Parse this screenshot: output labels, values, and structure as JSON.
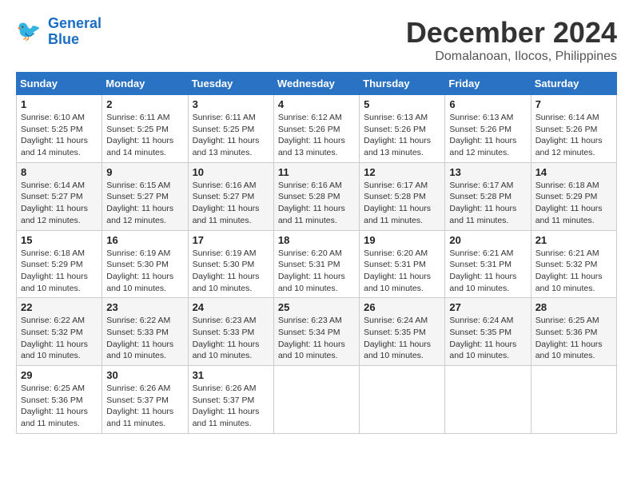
{
  "logo": {
    "line1": "General",
    "line2": "Blue"
  },
  "title": "December 2024",
  "location": "Domalanoan, Ilocos, Philippines",
  "days_of_week": [
    "Sunday",
    "Monday",
    "Tuesday",
    "Wednesday",
    "Thursday",
    "Friday",
    "Saturday"
  ],
  "weeks": [
    [
      {
        "day": "1",
        "sunrise": "6:10 AM",
        "sunset": "5:25 PM",
        "daylight": "11 hours and 14 minutes."
      },
      {
        "day": "2",
        "sunrise": "6:11 AM",
        "sunset": "5:25 PM",
        "daylight": "11 hours and 14 minutes."
      },
      {
        "day": "3",
        "sunrise": "6:11 AM",
        "sunset": "5:25 PM",
        "daylight": "11 hours and 13 minutes."
      },
      {
        "day": "4",
        "sunrise": "6:12 AM",
        "sunset": "5:26 PM",
        "daylight": "11 hours and 13 minutes."
      },
      {
        "day": "5",
        "sunrise": "6:13 AM",
        "sunset": "5:26 PM",
        "daylight": "11 hours and 13 minutes."
      },
      {
        "day": "6",
        "sunrise": "6:13 AM",
        "sunset": "5:26 PM",
        "daylight": "11 hours and 12 minutes."
      },
      {
        "day": "7",
        "sunrise": "6:14 AM",
        "sunset": "5:26 PM",
        "daylight": "11 hours and 12 minutes."
      }
    ],
    [
      {
        "day": "8",
        "sunrise": "6:14 AM",
        "sunset": "5:27 PM",
        "daylight": "11 hours and 12 minutes."
      },
      {
        "day": "9",
        "sunrise": "6:15 AM",
        "sunset": "5:27 PM",
        "daylight": "11 hours and 12 minutes."
      },
      {
        "day": "10",
        "sunrise": "6:16 AM",
        "sunset": "5:27 PM",
        "daylight": "11 hours and 11 minutes."
      },
      {
        "day": "11",
        "sunrise": "6:16 AM",
        "sunset": "5:28 PM",
        "daylight": "11 hours and 11 minutes."
      },
      {
        "day": "12",
        "sunrise": "6:17 AM",
        "sunset": "5:28 PM",
        "daylight": "11 hours and 11 minutes."
      },
      {
        "day": "13",
        "sunrise": "6:17 AM",
        "sunset": "5:28 PM",
        "daylight": "11 hours and 11 minutes."
      },
      {
        "day": "14",
        "sunrise": "6:18 AM",
        "sunset": "5:29 PM",
        "daylight": "11 hours and 11 minutes."
      }
    ],
    [
      {
        "day": "15",
        "sunrise": "6:18 AM",
        "sunset": "5:29 PM",
        "daylight": "11 hours and 10 minutes."
      },
      {
        "day": "16",
        "sunrise": "6:19 AM",
        "sunset": "5:30 PM",
        "daylight": "11 hours and 10 minutes."
      },
      {
        "day": "17",
        "sunrise": "6:19 AM",
        "sunset": "5:30 PM",
        "daylight": "11 hours and 10 minutes."
      },
      {
        "day": "18",
        "sunrise": "6:20 AM",
        "sunset": "5:31 PM",
        "daylight": "11 hours and 10 minutes."
      },
      {
        "day": "19",
        "sunrise": "6:20 AM",
        "sunset": "5:31 PM",
        "daylight": "11 hours and 10 minutes."
      },
      {
        "day": "20",
        "sunrise": "6:21 AM",
        "sunset": "5:31 PM",
        "daylight": "11 hours and 10 minutes."
      },
      {
        "day": "21",
        "sunrise": "6:21 AM",
        "sunset": "5:32 PM",
        "daylight": "11 hours and 10 minutes."
      }
    ],
    [
      {
        "day": "22",
        "sunrise": "6:22 AM",
        "sunset": "5:32 PM",
        "daylight": "11 hours and 10 minutes."
      },
      {
        "day": "23",
        "sunrise": "6:22 AM",
        "sunset": "5:33 PM",
        "daylight": "11 hours and 10 minutes."
      },
      {
        "day": "24",
        "sunrise": "6:23 AM",
        "sunset": "5:33 PM",
        "daylight": "11 hours and 10 minutes."
      },
      {
        "day": "25",
        "sunrise": "6:23 AM",
        "sunset": "5:34 PM",
        "daylight": "11 hours and 10 minutes."
      },
      {
        "day": "26",
        "sunrise": "6:24 AM",
        "sunset": "5:35 PM",
        "daylight": "11 hours and 10 minutes."
      },
      {
        "day": "27",
        "sunrise": "6:24 AM",
        "sunset": "5:35 PM",
        "daylight": "11 hours and 10 minutes."
      },
      {
        "day": "28",
        "sunrise": "6:25 AM",
        "sunset": "5:36 PM",
        "daylight": "11 hours and 10 minutes."
      }
    ],
    [
      {
        "day": "29",
        "sunrise": "6:25 AM",
        "sunset": "5:36 PM",
        "daylight": "11 hours and 11 minutes."
      },
      {
        "day": "30",
        "sunrise": "6:26 AM",
        "sunset": "5:37 PM",
        "daylight": "11 hours and 11 minutes."
      },
      {
        "day": "31",
        "sunrise": "6:26 AM",
        "sunset": "5:37 PM",
        "daylight": "11 hours and 11 minutes."
      },
      null,
      null,
      null,
      null
    ]
  ]
}
